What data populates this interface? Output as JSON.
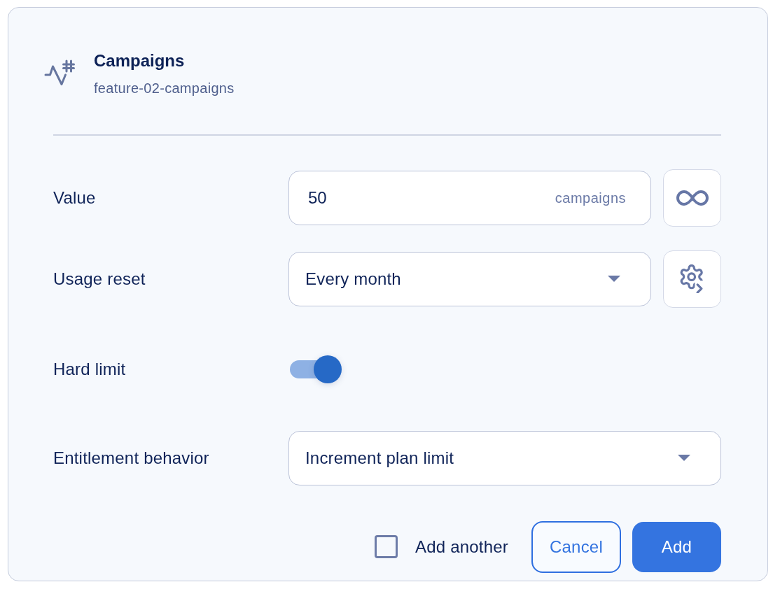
{
  "header": {
    "title": "Campaigns",
    "subtitle": "feature-02-campaigns"
  },
  "fields": [
    {
      "kind": "number",
      "label": "Value",
      "value": "50",
      "unit": "campaigns",
      "side_button": {
        "kind": "unlimited"
      }
    },
    {
      "kind": "select",
      "label": "Usage reset",
      "value": "Every month",
      "side_button": {
        "kind": "settings"
      }
    },
    {
      "kind": "toggle",
      "label": "Hard limit",
      "on": true
    },
    {
      "kind": "select",
      "label": "Entitlement behavior",
      "value": "Increment plan limit"
    }
  ],
  "footer": {
    "add_another": {
      "label": "Add another",
      "checked": false
    },
    "buttons": [
      {
        "kind": "secondary",
        "label": "Cancel"
      },
      {
        "kind": "primary",
        "label": "Add"
      }
    ]
  }
}
